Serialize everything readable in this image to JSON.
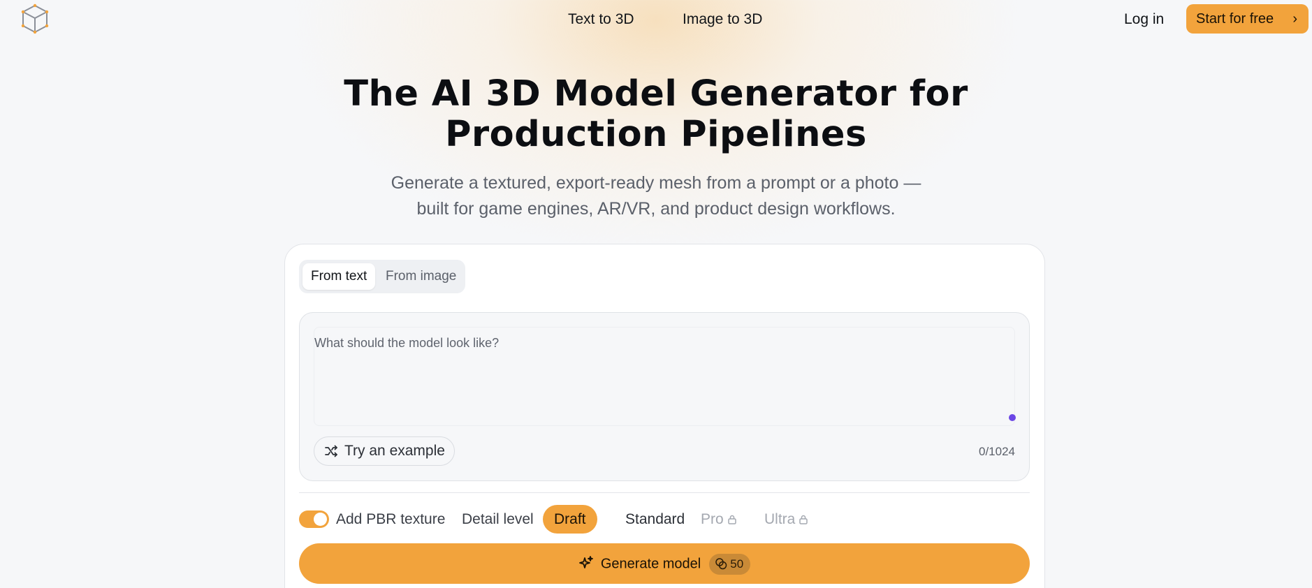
{
  "header": {
    "logo_icon": "cube-icon",
    "nav": [
      {
        "label": "Text to 3D"
      },
      {
        "label": "Image to 3D"
      }
    ],
    "login_label": "Log in",
    "cta_label": "Start for free",
    "cta_icon": "chevron-right-icon"
  },
  "hero": {
    "title_line1": "The AI 3D Model Generator for",
    "title_line2": "Production Pipelines",
    "subtitle_line1": "Generate a textured, export-ready mesh from a prompt or a photo —",
    "subtitle_line2": "built for game engines, AR/VR, and product design workflows."
  },
  "generator": {
    "tabs": [
      {
        "label": "From text",
        "active": true
      },
      {
        "label": "From image",
        "active": false
      }
    ],
    "prompt": {
      "placeholder": "What should the model look like?",
      "value": "",
      "char_count": "0/1024"
    },
    "try_example_label": "Try an example",
    "try_example_icon": "shuffle-icon",
    "options": {
      "pbr_toggle_on": true,
      "pbr_label": "Add PBR texture",
      "detail_label": "Detail level",
      "levels": [
        {
          "label": "Draft",
          "selected": true,
          "locked": false
        },
        {
          "label": "Standard",
          "selected": false,
          "locked": false
        },
        {
          "label": "Pro",
          "selected": false,
          "locked": true
        },
        {
          "label": "Ultra",
          "selected": false,
          "locked": true
        }
      ]
    },
    "generate": {
      "label": "Generate model",
      "icon": "sparkles-icon",
      "cost_icon": "coins-icon",
      "cost": "50"
    }
  },
  "colors": {
    "accent": "#f2a33c",
    "text": "#111418",
    "muted": "#5b606a",
    "dot": "#6b46e5"
  }
}
